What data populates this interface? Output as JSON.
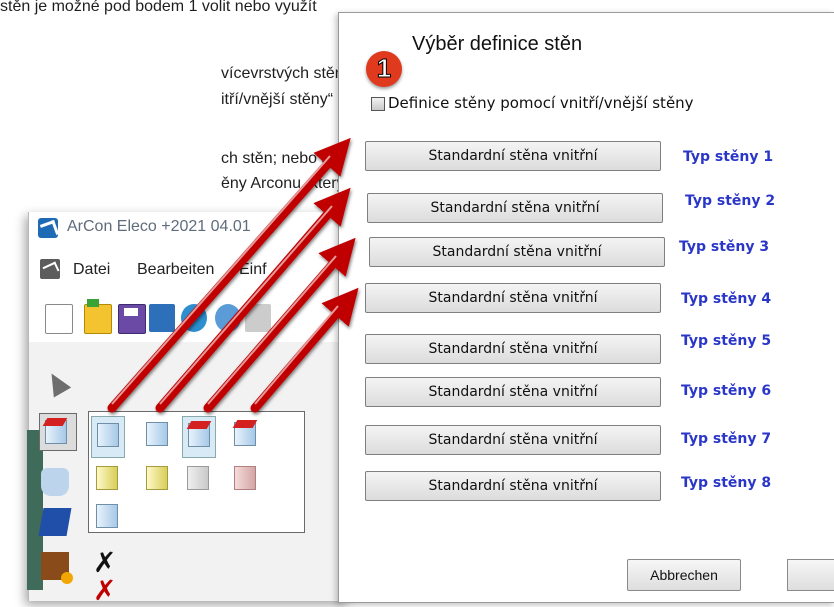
{
  "document": {
    "lines": [
      "stěn je možné pod bodem 1 volit nebo využít",
      "vícevrstvých stěn je",
      "itří/vnější stěny“ buď",
      "ch stěn; nebo alternativně",
      "ěny Arconu, který"
    ]
  },
  "arcon": {
    "title": "ArCon Eleco  +2021 04.01",
    "menu": [
      "Datei",
      "Bearbeiten",
      "Einf"
    ]
  },
  "dialog": {
    "step_number": "1",
    "title": "Výběr definice stěn",
    "checkbox_label": "Definice stěny pomocí vnitří/vnější stěny",
    "wall_types": [
      {
        "button": "Standardní stěna vnitřní",
        "label": "Typ stěny 1"
      },
      {
        "button": "Standardní stěna vnitřní",
        "label": "Typ stěny 2"
      },
      {
        "button": "Standardní stěna vnitřní",
        "label": "Typ stěny 3"
      },
      {
        "button": "Standardní stěna vnitřní",
        "label": "Typ stěny 4"
      },
      {
        "button": "Standardní stěna vnitřní",
        "label": "Typ stěny 5"
      },
      {
        "button": "Standardní stěna vnitřní",
        "label": "Typ stěny 6"
      },
      {
        "button": "Standardní stěna vnitřní",
        "label": "Typ stěny 7"
      },
      {
        "button": "Standardní stěna vnitřní",
        "label": "Typ stěny 8"
      }
    ],
    "cancel_label": "Abbrechen"
  },
  "colors": {
    "type_label": "#2a36c8",
    "arrow": "#c00000",
    "badge": "#e03a1e"
  }
}
